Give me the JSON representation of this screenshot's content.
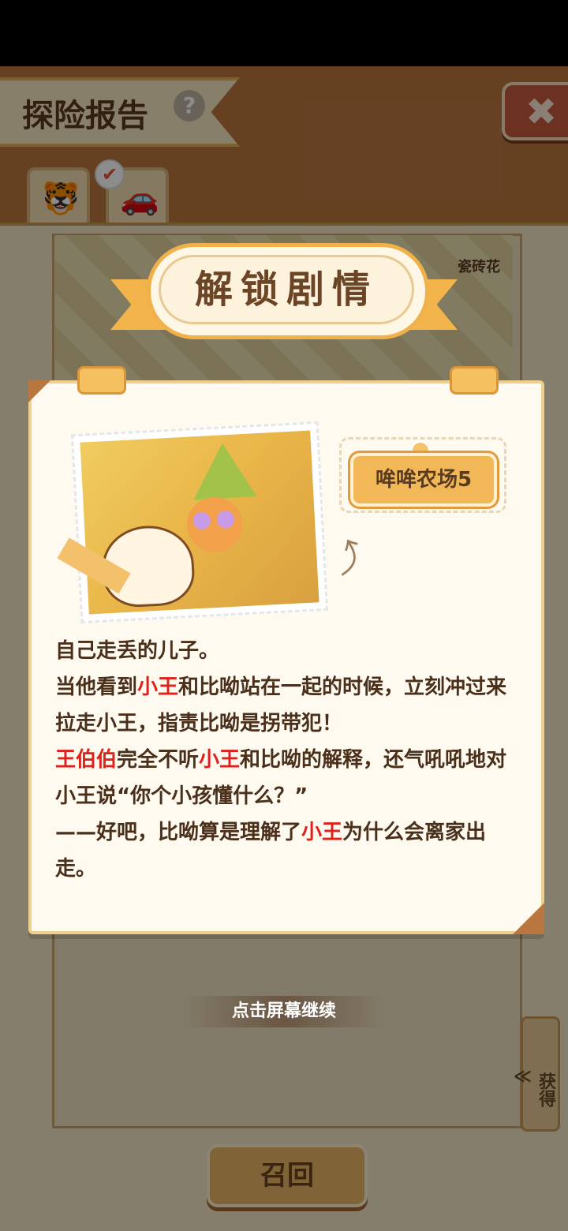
{
  "header": {
    "title": "探险报告",
    "help_icon": "?",
    "close_icon": "✖"
  },
  "tabs": [
    {
      "name": "tiger-tab",
      "icon": "🐯"
    },
    {
      "name": "car-tab",
      "icon": "🚗",
      "checked": true
    }
  ],
  "map": {
    "location_sign": "瓷砖花"
  },
  "modal": {
    "title": "解锁剧情",
    "location_tag": "哞哞农场5",
    "story": {
      "line1": "自己走丢的儿子。",
      "line2_a": "当他看到",
      "line2_hl": "小王",
      "line2_b": "和比呦站在一起的时候，立刻冲过来拉走小王，指责比呦是拐带犯！",
      "line3_hl1": "王伯伯",
      "line3_a": "完全不听",
      "line3_hl2": "小王",
      "line3_b": "和比呦的解释，还气吼吼地对小王说“你个小孩懂什么？”",
      "line4_a": "——好吧，比呦算是理解了",
      "line4_hl": "小王",
      "line4_b": "为什么会离家出走。"
    }
  },
  "continue_text": "点击屏幕继续",
  "obtain_tag": "获得",
  "obtain_chevron": "≪",
  "recall_button": "召回",
  "colors": {
    "highlight": "#e0201b",
    "ribbon": "#f2b44b",
    "background": "#b9773f"
  }
}
